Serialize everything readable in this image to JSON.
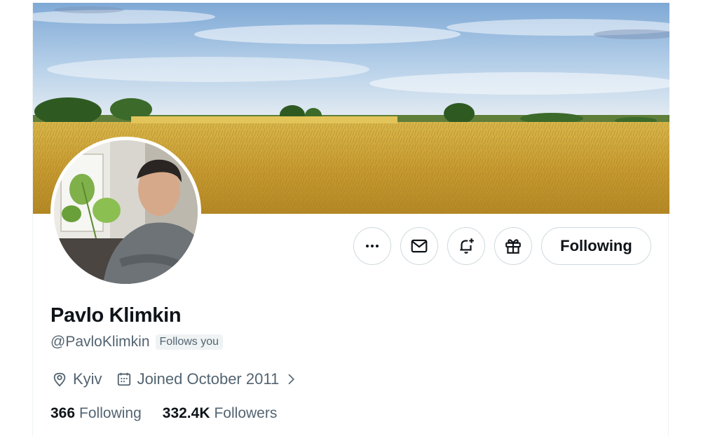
{
  "profile": {
    "display_name": "Pavlo Klimkin",
    "handle": "@PavloKlimkin",
    "follows_you_badge": "Follows you",
    "location": "Kyiv",
    "joined": "Joined October 2011",
    "following_count": "366",
    "following_label": "Following",
    "followers_count": "332.4K",
    "followers_label": "Followers"
  },
  "actions": {
    "more_icon": "more-horizontal-icon",
    "message_icon": "envelope-icon",
    "notify_icon": "bell-plus-icon",
    "gift_icon": "gift-icon",
    "follow_state_label": "Following"
  },
  "colors": {
    "text_primary": "#0f1419",
    "text_secondary": "#536471",
    "border": "#cfd9de",
    "badge_bg": "#eff3f4"
  }
}
